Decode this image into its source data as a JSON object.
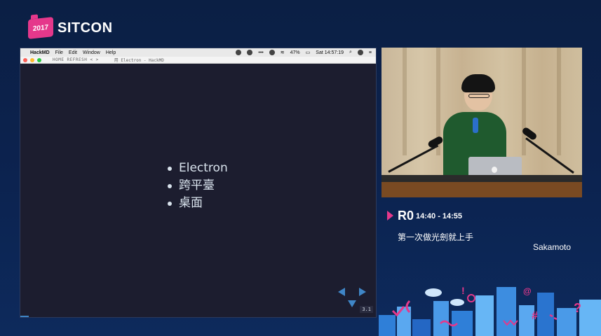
{
  "logo": {
    "year": "2017",
    "name": "SITCON"
  },
  "menubar": {
    "apple": "",
    "app": "HackMD",
    "items": [
      "File",
      "Edit",
      "Window",
      "Help"
    ],
    "battery": "47%",
    "clock": "Sat 14:57:19"
  },
  "titlebar": {
    "nav": "HOME REFRESH  <  >",
    "title": "用 Electron - HackMD"
  },
  "slide": {
    "bullets": [
      "Electron",
      "跨平臺",
      "桌面"
    ],
    "number": "3.1"
  },
  "session": {
    "room": "R0",
    "time": "14:40 - 14:55",
    "title": "第一次做光劍就上手",
    "speaker": "Sakamoto"
  },
  "colors": {
    "accent": "#e5388b",
    "nav": "#3f86c7",
    "background": "#0c2350"
  }
}
